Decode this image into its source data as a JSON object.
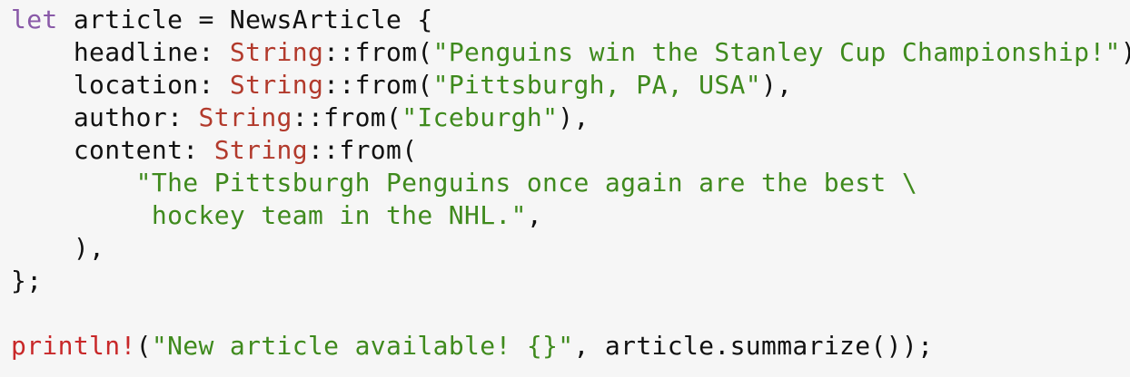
{
  "code_block": {
    "colors": {
      "background": "#f6f6f6",
      "text": "#111111",
      "keyword": "#8959a8",
      "type": "#b23a2c",
      "string": "#3f8a1d",
      "macro": "#c82829"
    },
    "lines": [
      [
        {
          "t": "let",
          "c": "kw"
        },
        {
          "t": " article = NewsArticle {",
          "c": "plain"
        }
      ],
      [
        {
          "t": "    headline: ",
          "c": "plain"
        },
        {
          "t": "String",
          "c": "ty"
        },
        {
          "t": "::from(",
          "c": "plain"
        },
        {
          "t": "\"Penguins win the Stanley Cup Championship!\"",
          "c": "str"
        },
        {
          "t": "),",
          "c": "plain"
        }
      ],
      [
        {
          "t": "    location: ",
          "c": "plain"
        },
        {
          "t": "String",
          "c": "ty"
        },
        {
          "t": "::from(",
          "c": "plain"
        },
        {
          "t": "\"Pittsburgh, PA, USA\"",
          "c": "str"
        },
        {
          "t": "),",
          "c": "plain"
        }
      ],
      [
        {
          "t": "    author: ",
          "c": "plain"
        },
        {
          "t": "String",
          "c": "ty"
        },
        {
          "t": "::from(",
          "c": "plain"
        },
        {
          "t": "\"Iceburgh\"",
          "c": "str"
        },
        {
          "t": "),",
          "c": "plain"
        }
      ],
      [
        {
          "t": "    content: ",
          "c": "plain"
        },
        {
          "t": "String",
          "c": "ty"
        },
        {
          "t": "::from(",
          "c": "plain"
        }
      ],
      [
        {
          "t": "        \"The Pittsburgh Penguins once again are the best \\",
          "c": "str"
        }
      ],
      [
        {
          "t": "         hockey team in the NHL.\"",
          "c": "str"
        },
        {
          "t": ",",
          "c": "plain"
        }
      ],
      [
        {
          "t": "    ),",
          "c": "plain"
        }
      ],
      [
        {
          "t": "};",
          "c": "plain"
        }
      ],
      [
        {
          "t": "",
          "c": "plain"
        }
      ],
      [
        {
          "t": "println!",
          "c": "mac"
        },
        {
          "t": "(",
          "c": "plain"
        },
        {
          "t": "\"New article available! {}\"",
          "c": "str"
        },
        {
          "t": ", article.summarize());",
          "c": "plain"
        }
      ]
    ]
  }
}
